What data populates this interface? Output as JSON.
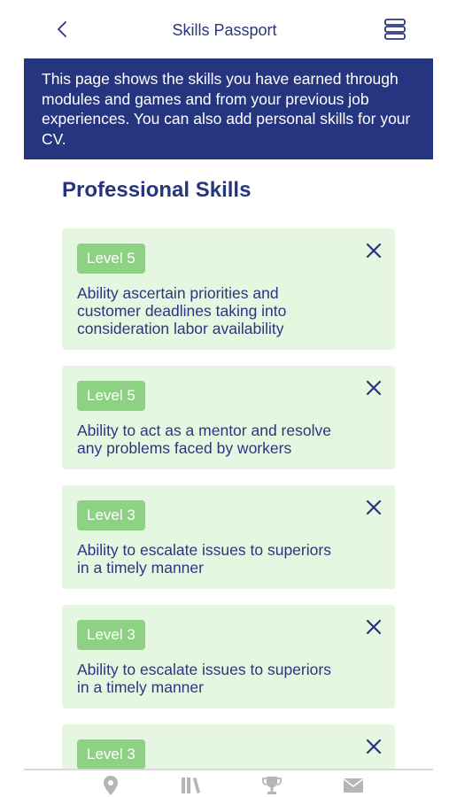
{
  "header": {
    "title": "Skills Passport",
    "back_icon": "chevron-left-icon",
    "menu_icon": "menu-icon"
  },
  "banner": {
    "text": "This page shows the skills you have earned through modules and games and from your previous job experiences. You can also add personal skills for your CV."
  },
  "section": {
    "title": "Professional Skills"
  },
  "skills": [
    {
      "level": "Level 5",
      "text": "Ability ascertain priorities and customer deadlines taking into consideration labor availability"
    },
    {
      "level": "Level 5",
      "text": "Ability to act as a mentor and resolve any problems faced by workers"
    },
    {
      "level": "Level 3",
      "text": "Ability to escalate issues to superiors in a timely manner"
    },
    {
      "level": "Level 3",
      "text": "Ability to escalate issues to superiors in a timely manner"
    },
    {
      "level": "Level 3",
      "text": ""
    }
  ],
  "bottom_nav": [
    {
      "icon": "map-pin-icon"
    },
    {
      "icon": "library-icon"
    },
    {
      "icon": "trophy-icon"
    },
    {
      "icon": "mail-icon"
    }
  ],
  "colors": {
    "primary": "#26357f",
    "card_bg": "#e5f7e0",
    "badge_bg": "#8dd283",
    "nav_icon": "#b5b5b5"
  }
}
